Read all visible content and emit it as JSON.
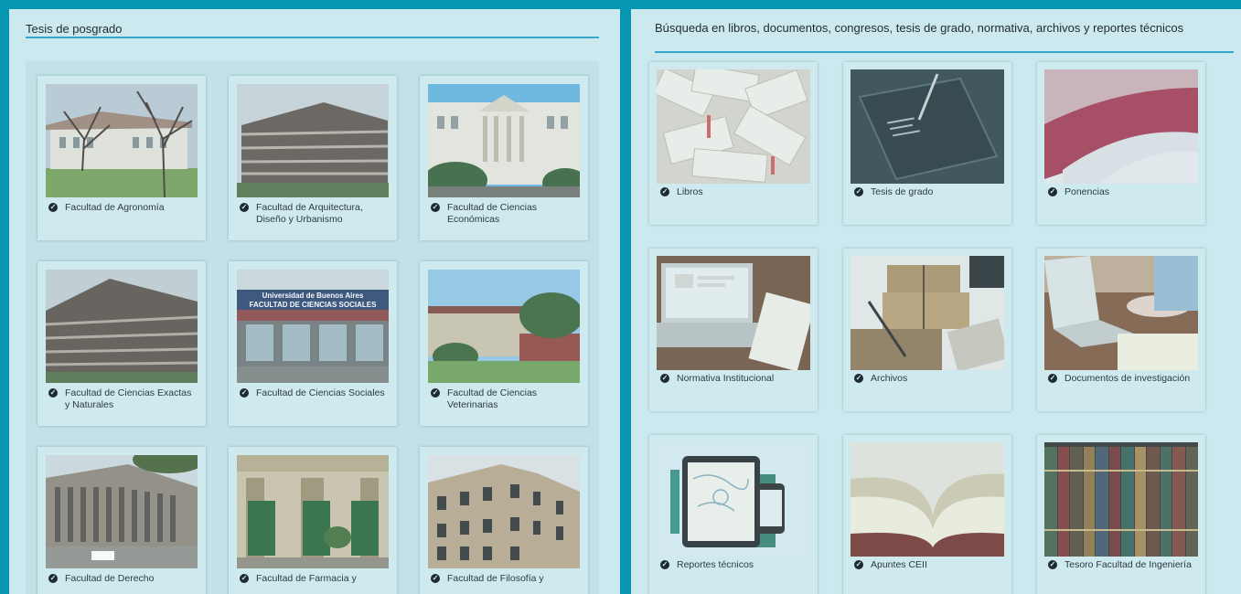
{
  "left_panel": {
    "title": "Tesis de posgrado",
    "cards": [
      {
        "label": "Facultad de Agronomía",
        "icon": "check-circle-icon"
      },
      {
        "label": "Facultad de Arquitectura, Diseño y Urbanismo",
        "icon": "check-circle-icon"
      },
      {
        "label": "Facultad de Ciencias Económicas",
        "icon": "check-circle-icon"
      },
      {
        "label": "Facultad de Ciencias Exactas y Naturales",
        "icon": "check-circle-icon"
      },
      {
        "label": "Facultad de Ciencias Sociales",
        "icon": "check-circle-icon"
      },
      {
        "label": "Facultad de Ciencias Veterinarias",
        "icon": "check-circle-icon"
      },
      {
        "label": "Facultad de Derecho",
        "icon": "check-circle-icon"
      },
      {
        "label": "Facultad de Farmacia y",
        "icon": "check-circle-icon"
      },
      {
        "label": "Facultad de Filosofía y",
        "icon": "check-circle-icon"
      }
    ],
    "sign_text": "Universidad de Buenos Aires FACULTAD DE CIENCIAS SOCIALES"
  },
  "right_panel": {
    "title": "Búsqueda en libros, documentos, congresos, tesis de grado, normativa, archivos y reportes técnicos",
    "cards": [
      {
        "label": "Libros",
        "icon": "check-circle-icon"
      },
      {
        "label": "Tesis de grado",
        "icon": "check-circle-icon"
      },
      {
        "label": "Ponencias",
        "icon": "check-circle-icon"
      },
      {
        "label": "Normativa Institucional",
        "icon": "check-circle-icon"
      },
      {
        "label": "Archivos",
        "icon": "check-circle-icon"
      },
      {
        "label": "Documentos de investigación",
        "icon": "check-circle-icon"
      },
      {
        "label": "Reportes técnicos",
        "icon": "check-circle-icon"
      },
      {
        "label": "Apuntes CEII",
        "icon": "check-circle-icon"
      },
      {
        "label": "Tesoro Facultad de Ingeniería",
        "icon": "check-circle-icon"
      }
    ]
  },
  "colors": {
    "frame": "#0797b3",
    "panel": "#cce9ef",
    "accent_rule": "#36a7c9",
    "text": "#1d2b30"
  }
}
